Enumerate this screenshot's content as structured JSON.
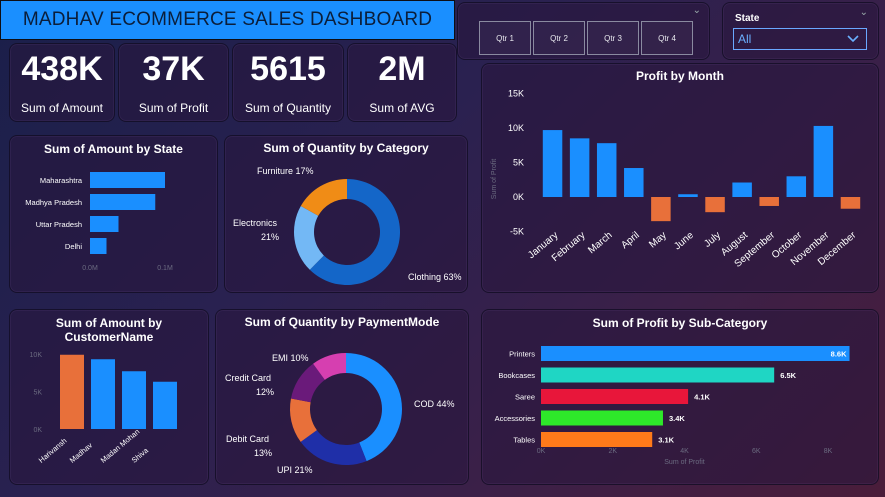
{
  "header": {
    "title": "MADHAV ECOMMERCE SALES DASHBOARD"
  },
  "kpis": [
    {
      "value": "438K",
      "label": "Sum of Amount"
    },
    {
      "value": "37K",
      "label": "Sum of Profit"
    },
    {
      "value": "5615",
      "label": "Sum of Quantity"
    },
    {
      "value": "2M",
      "label": "Sum of AVG"
    }
  ],
  "quarter_slicer": {
    "options": [
      "Qtr 1",
      "Qtr 2",
      "Qtr 3",
      "Qtr 4"
    ]
  },
  "state_slicer": {
    "label": "State",
    "selected": "All"
  },
  "colors": {
    "accent": "#1a8fff",
    "orange": "#e8703a"
  },
  "chart_data": [
    {
      "id": "amount_by_state",
      "type": "bar",
      "orientation": "horizontal",
      "title": "Sum of Amount by State",
      "categories": [
        "Maharashtra",
        "Madhya Pradesh",
        "Uttar Pradesh",
        "Delhi"
      ],
      "values": [
        100000,
        87000,
        38000,
        22000
      ],
      "xticks": [
        "0.0M",
        "0.1M"
      ],
      "xlim": [
        0,
        100000
      ]
    },
    {
      "id": "quantity_by_category",
      "type": "pie",
      "donut": true,
      "title": "Sum of Quantity by Category",
      "labels": [
        "Clothing",
        "Electronics",
        "Furniture"
      ],
      "values": [
        63,
        21,
        17
      ],
      "display_labels": [
        "Clothing 63%",
        "Electronics 21%",
        "Furniture 17%"
      ],
      "colors": [
        "#1466c8",
        "#73b8f5",
        "#f08c16"
      ]
    },
    {
      "id": "profit_by_month",
      "type": "bar",
      "title": "Profit by Month",
      "ylabel": "Sum of Profit",
      "categories": [
        "January",
        "February",
        "March",
        "April",
        "May",
        "June",
        "July",
        "August",
        "September",
        "October",
        "November",
        "December"
      ],
      "values": [
        9700,
        8500,
        7800,
        4200,
        -3500,
        400,
        -2200,
        2100,
        -1300,
        3000,
        10300,
        -1700
      ],
      "yticks": [
        "15K",
        "10K",
        "5K",
        "0K",
        "-5K"
      ],
      "ylim": [
        -5000,
        15000
      ],
      "colors": {
        "positive": "#1a8fff",
        "negative": "#e8703a"
      }
    },
    {
      "id": "amount_by_customer",
      "type": "bar",
      "title": "Sum of Amount by CustomerName",
      "categories": [
        "Harivansh",
        "Madhav",
        "Madan Mohan",
        "Shiva"
      ],
      "values": [
        9900,
        9300,
        7700,
        6300
      ],
      "yticks": [
        "10K",
        "5K",
        "0K"
      ],
      "ylim": [
        0,
        10000
      ],
      "colors": [
        "#e8703a",
        "#1a8fff",
        "#1a8fff",
        "#1a8fff"
      ]
    },
    {
      "id": "quantity_by_paymentmode",
      "type": "pie",
      "donut": true,
      "title": "Sum of Quantity by PaymentMode",
      "labels": [
        "COD",
        "UPI",
        "Debit Card",
        "Credit Card",
        "EMI"
      ],
      "values": [
        44,
        21,
        13,
        12,
        10
      ],
      "display_labels": [
        "COD 44%",
        "UPI 21%",
        "Debit Card",
        "13%",
        "Credit Card",
        "12%",
        "EMI 10%"
      ],
      "colors": [
        "#1a8fff",
        "#1f2fa8",
        "#e8703a",
        "#6a1a7a",
        "#d63fb0"
      ]
    },
    {
      "id": "profit_by_subcategory",
      "type": "bar",
      "orientation": "horizontal",
      "title": "Sum of Profit by Sub-Category",
      "xlabel": "Sum of Profit",
      "categories": [
        "Printers",
        "Bookcases",
        "Saree",
        "Accessories",
        "Tables"
      ],
      "values": [
        8600,
        6500,
        4100,
        3400,
        3100
      ],
      "data_labels": [
        "8.6K",
        "6.5K",
        "4.1K",
        "3.4K",
        "3.1K"
      ],
      "xticks": [
        "0K",
        "2K",
        "4K",
        "6K",
        "8K"
      ],
      "xlim": [
        0,
        8000
      ],
      "colors": [
        "#1a8fff",
        "#1fd6c4",
        "#e8163a",
        "#2ee82a",
        "#ff7a1a"
      ]
    }
  ]
}
